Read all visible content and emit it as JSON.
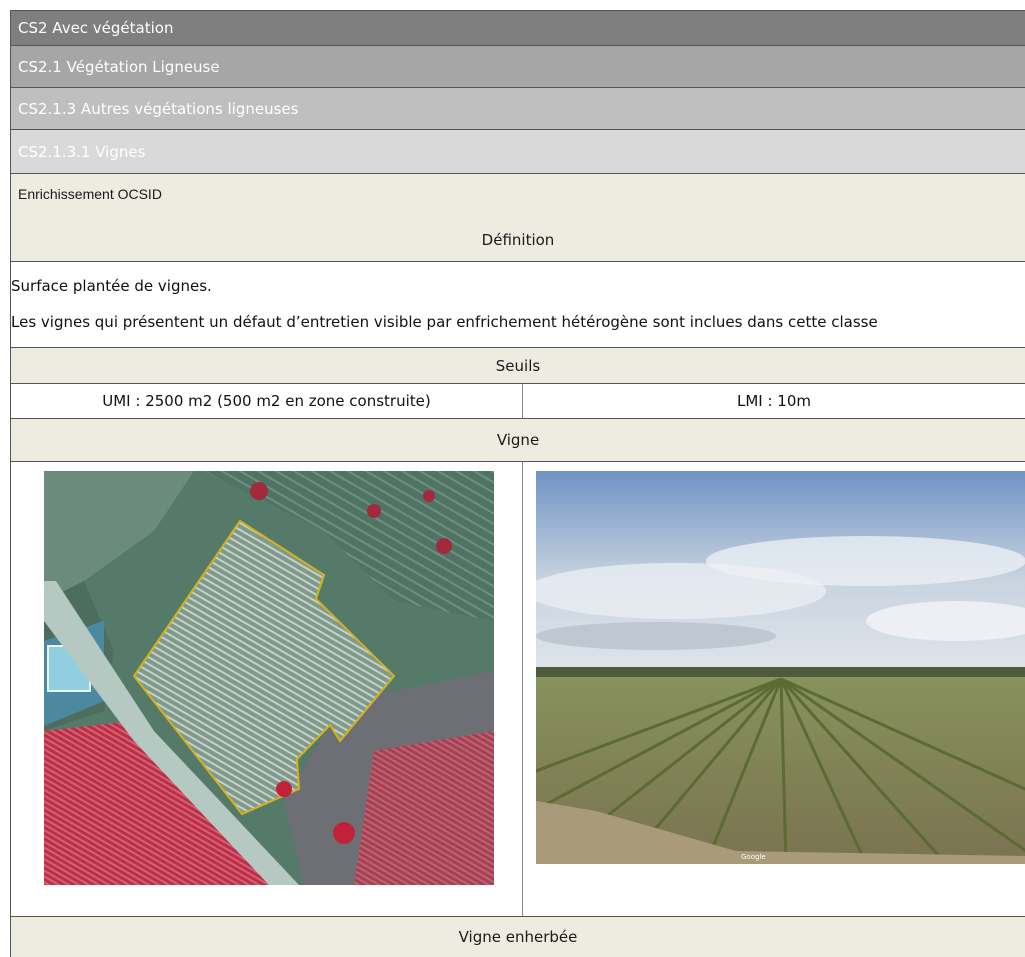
{
  "hierarchy": {
    "level1": "CS2 Avec végétation",
    "level2": "CS2.1 Végétation Ligneuse",
    "level3": "CS2.1.3 Autres végétations ligneuses",
    "level4": "CS2.1.3.1 Vignes"
  },
  "enrichment": "Enrichissement OCSID",
  "definition": {
    "title": "Définition",
    "lines": [
      "Surface plantée de vignes.",
      "Les vignes qui présentent un défaut d’entretien visible par enfrichement hétérogène sont inclues dans cette classe"
    ]
  },
  "thresholds": {
    "title": "Seuils",
    "umi": "UMI : 2500 m2 (500 m2 en zone construite)",
    "lmi": "LMI : 10m"
  },
  "examples": [
    {
      "title": "Vigne",
      "watermark": "Google"
    },
    {
      "title": "Vigne enherbée"
    }
  ],
  "colors": {
    "level1": "#7f7f7f",
    "level2": "#a6a6a6",
    "level3": "#bfbfbf",
    "level4": "#d9d9d9",
    "beige": "#eeece1",
    "parcel_outline": "#d4b21a"
  }
}
